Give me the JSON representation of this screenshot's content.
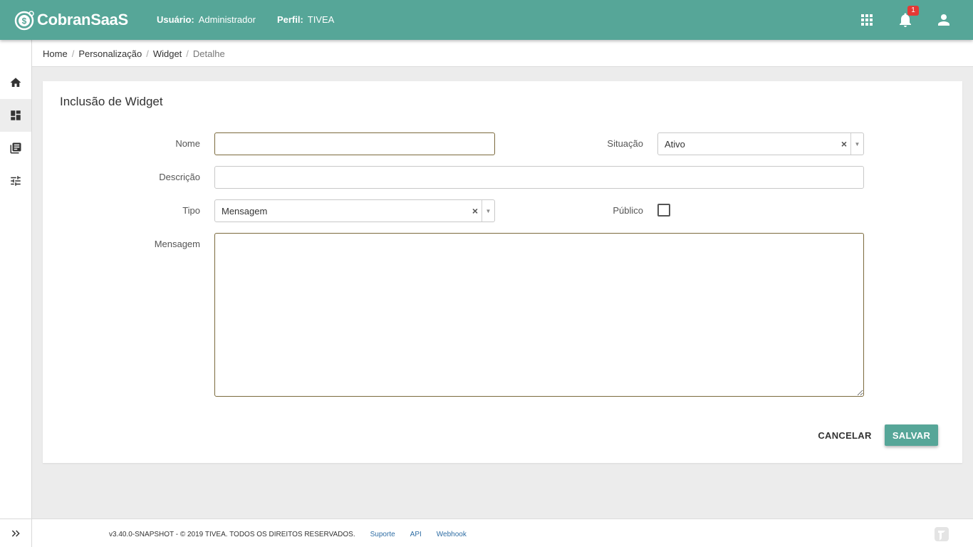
{
  "header": {
    "brand": "CobranSaaS",
    "user_label": "Usuário:",
    "user_value": "Administrador",
    "profile_label": "Perfil:",
    "profile_value": "TIVEA",
    "notification_count": "1"
  },
  "sidebar": {
    "items": [
      {
        "icon": "home-icon"
      },
      {
        "icon": "dashboard-icon",
        "active": true
      },
      {
        "icon": "library-icon"
      },
      {
        "icon": "tune-icon"
      }
    ]
  },
  "breadcrumb": [
    "Home",
    "Personalização",
    "Widget",
    "Detalhe"
  ],
  "form": {
    "title": "Inclusão de Widget",
    "nome_label": "Nome",
    "nome_value": "",
    "situacao_label": "Situação",
    "situacao_value": "Ativo",
    "descricao_label": "Descrição",
    "descricao_value": "",
    "tipo_label": "Tipo",
    "tipo_value": "Mensagem",
    "publico_label": "Público",
    "publico_checked": false,
    "mensagem_label": "Mensagem",
    "mensagem_value": "",
    "cancel_label": "CANCELAR",
    "save_label": "SALVAR"
  },
  "footer": {
    "copyright": "v3.40.0-SNAPSHOT - © 2019 TIVEA. TODOS OS DIREITOS RESERVADOS.",
    "links": [
      "Suporte",
      "API",
      "Webhook"
    ]
  },
  "colors": {
    "primary": "#56a698",
    "badge": "#e53935",
    "focus_border": "#7b6a3d"
  }
}
